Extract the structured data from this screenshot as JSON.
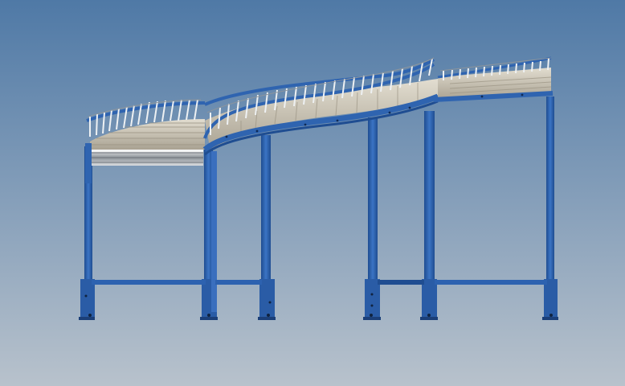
{
  "scene": {
    "subject": "conveyor-render",
    "colors": {
      "sky_top": "#4f79a6",
      "sky_bottom": "#b8c2cc",
      "frame_blue": "#2f64b0",
      "frame_blue_dark": "#1f4d91",
      "frame_blue_light": "#5a8ad0",
      "roller_light": "#d8d2c4",
      "roller_mid": "#b8b1a2",
      "roller_dark": "#8d8778",
      "guard_silver": "#e8ecef",
      "guard_shadow": "#9aa3ab"
    },
    "sections": [
      {
        "id": "left-curve"
      },
      {
        "id": "middle-s-curve"
      },
      {
        "id": "right-straight"
      }
    ],
    "support_legs": [
      {
        "id": "leg-1"
      },
      {
        "id": "leg-2"
      },
      {
        "id": "leg-3"
      },
      {
        "id": "leg-4"
      },
      {
        "id": "leg-5"
      },
      {
        "id": "leg-6"
      },
      {
        "id": "leg-7"
      }
    ]
  }
}
